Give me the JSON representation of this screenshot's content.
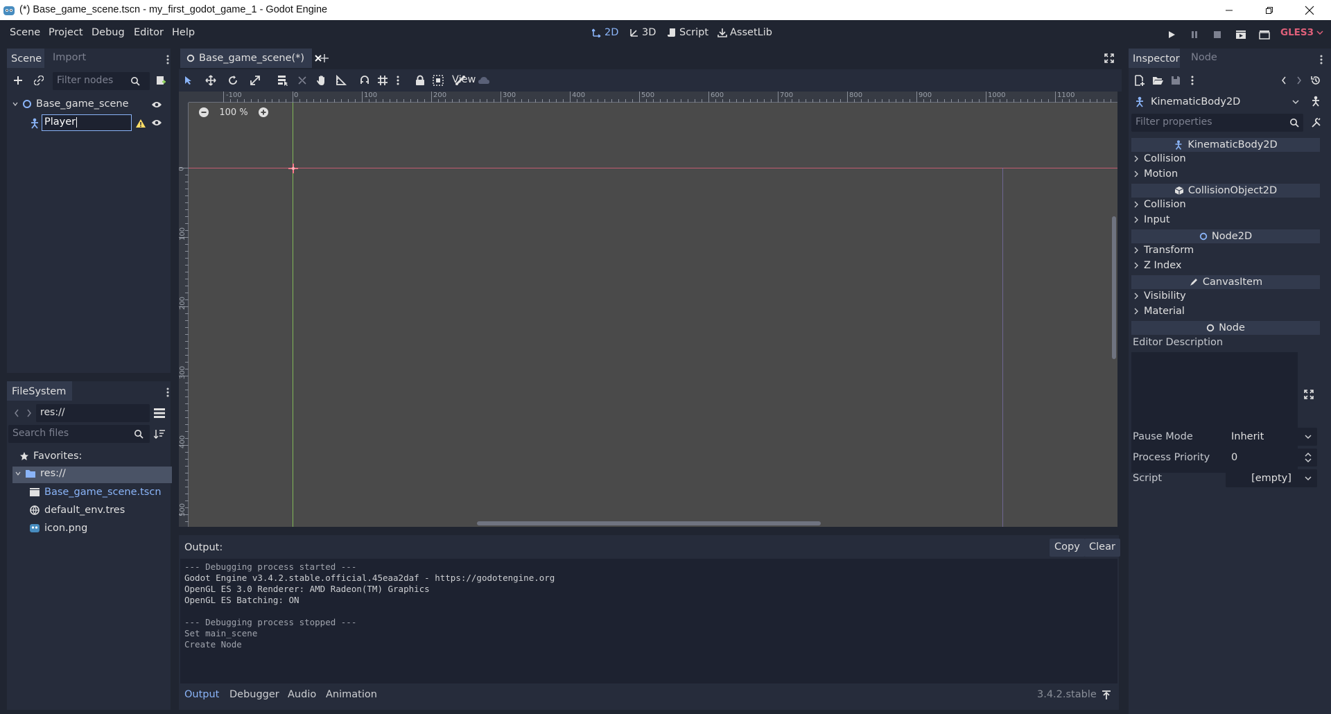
{
  "window": {
    "title": "(*) Base_game_scene.tscn - my_first_godot_game_1 - Godot Engine"
  },
  "menu": {
    "items": [
      "Scene",
      "Project",
      "Debug",
      "Editor",
      "Help"
    ]
  },
  "workspaces": {
    "items": [
      {
        "label": "2D",
        "icon": "2d-icon",
        "active": true
      },
      {
        "label": "3D",
        "icon": "3d-icon",
        "active": false
      },
      {
        "label": "Script",
        "icon": "script-icon",
        "active": false
      },
      {
        "label": "AssetLib",
        "icon": "assetlib-icon",
        "active": false
      }
    ]
  },
  "renderer": "GLES3",
  "scene_dock": {
    "tabs": [
      "Scene",
      "Import"
    ],
    "filter_placeholder": "Filter nodes",
    "tree": [
      {
        "label": "Base_game_scene",
        "icon": "node2d-icon",
        "visible": true
      },
      {
        "label": "Player",
        "icon": "kinematicbody2d-icon",
        "visible": true,
        "warning": true,
        "editing": true
      }
    ]
  },
  "filesystem_dock": {
    "title": "FileSystem",
    "path": "res://",
    "search_placeholder": "Search files",
    "favorites_label": "Favorites:",
    "root_label": "res://",
    "files": [
      {
        "name": "Base_game_scene.tscn",
        "icon": "scene-file-icon",
        "highlight": true
      },
      {
        "name": "default_env.tres",
        "icon": "environment-icon",
        "highlight": false
      },
      {
        "name": "icon.png",
        "icon": "image-icon",
        "highlight": false
      }
    ]
  },
  "editor": {
    "scene_tab": "Base_game_scene(*)",
    "view_menu": "View",
    "zoom": "100 %",
    "ruler_top": [
      "-100",
      "0",
      "100",
      "200",
      "300",
      "400",
      "500",
      "600",
      "700",
      "800",
      "900",
      "1000",
      "1100"
    ],
    "ruler_left": [
      "0",
      "100",
      "200",
      "300",
      "400",
      "500"
    ]
  },
  "output": {
    "header": "Output:",
    "copy_label": "Copy",
    "clear_label": "Clear",
    "lines": [
      {
        "text": "--- Debugging process started ---",
        "dim": true
      },
      {
        "text": "Godot Engine v3.4.2.stable.official.45eaa2daf - https://godotengine.org",
        "dim": false
      },
      {
        "text": "OpenGL ES 3.0 Renderer: AMD Radeon(TM) Graphics",
        "dim": false
      },
      {
        "text": "OpenGL ES Batching: ON",
        "dim": false
      },
      {
        "text": "",
        "dim": false
      },
      {
        "text": "--- Debugging process stopped ---",
        "dim": true
      },
      {
        "text": "Set main_scene",
        "dim": true
      },
      {
        "text": "Create Node",
        "dim": true
      }
    ],
    "bottom_tabs": [
      "Output",
      "Debugger",
      "Audio",
      "Animation"
    ],
    "version": "3.4.2.stable"
  },
  "inspector": {
    "tabs": [
      "Inspector",
      "Node"
    ],
    "object_type": "KinematicBody2D",
    "filter_placeholder": "Filter properties",
    "sections": [
      {
        "type": "header",
        "label": "KinematicBody2D",
        "icon": "kinematicbody2d-icon"
      },
      {
        "type": "category",
        "label": "Collision"
      },
      {
        "type": "category",
        "label": "Motion"
      },
      {
        "type": "header",
        "label": "CollisionObject2D",
        "icon": "collisionobject2d-icon"
      },
      {
        "type": "category",
        "label": "Collision"
      },
      {
        "type": "category",
        "label": "Input"
      },
      {
        "type": "header",
        "label": "Node2D",
        "icon": "node2d-icon"
      },
      {
        "type": "category",
        "label": "Transform"
      },
      {
        "type": "category",
        "label": "Z Index"
      },
      {
        "type": "header",
        "label": "CanvasItem",
        "icon": "canvasitem-icon"
      },
      {
        "type": "category",
        "label": "Visibility"
      },
      {
        "type": "category",
        "label": "Material"
      },
      {
        "type": "header",
        "label": "Node",
        "icon": "node-icon"
      }
    ],
    "editor_description_label": "Editor Description",
    "properties": [
      {
        "label": "Pause Mode",
        "value": "Inherit",
        "control": "dropdown"
      },
      {
        "label": "Process Priority",
        "value": "0",
        "control": "spinbox"
      },
      {
        "label": "Script",
        "value": "[empty]",
        "control": "dropdown"
      }
    ]
  },
  "colors": {
    "accent": "#8ab4f8",
    "renderer": "#e0607a",
    "warning": "#ffdd65",
    "axis_x": "#e0607a",
    "axis_y": "#8fd35b",
    "viewport_bg": "#4a4a4a",
    "panel_bg": "#262c3b"
  }
}
